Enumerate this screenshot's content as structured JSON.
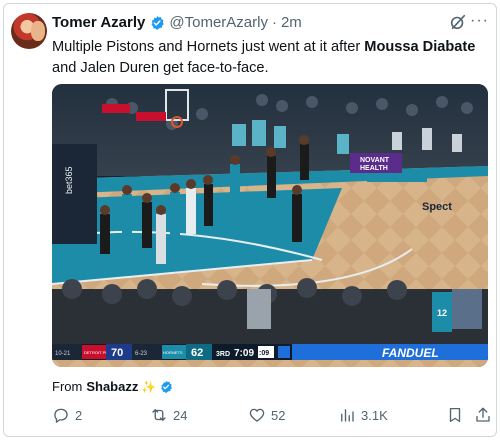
{
  "author": {
    "name": "Tomer Azarly",
    "handle": "@TomerAzarly",
    "separator": "·",
    "time": "2m",
    "avatar_icon": "profile-photo",
    "verified_color": "#1d9bf0"
  },
  "tweet": {
    "text_before": "Multiple Pistons and Hornets just went at it after ",
    "bold_1": "Moussa Diabate",
    "text_middle": " and Jalen Duren get face-to-face."
  },
  "media": {
    "arena_signs": {
      "novant_line1": "NOVANT",
      "novant_line2": "HEALTH",
      "spectrum": "Spect",
      "bet365": "bet365",
      "jersey_number": "12",
      "hornets_banner": "HORNETS"
    },
    "scoreboard": {
      "away_record": "10-21",
      "away_team_label": "DETROIT PISTONS",
      "away_score": "70",
      "home_record": "6-23",
      "home_team_label": "HORNETS",
      "home_score": "62",
      "quarter": "3RD",
      "clock": "7:09",
      "shot_clock": ":09",
      "sponsor": "FANDUEL"
    }
  },
  "source": {
    "label": "From",
    "name": "Shabazz",
    "emoji": "✨"
  },
  "actions": {
    "replies": "2",
    "reposts": "24",
    "likes": "52",
    "views": "3.1K"
  },
  "colors": {
    "text_primary": "#0f1419",
    "text_secondary": "#536471",
    "border": "#cfd9de",
    "hornets_teal": "#1d8ca8",
    "pistons_red": "#c8102e"
  }
}
